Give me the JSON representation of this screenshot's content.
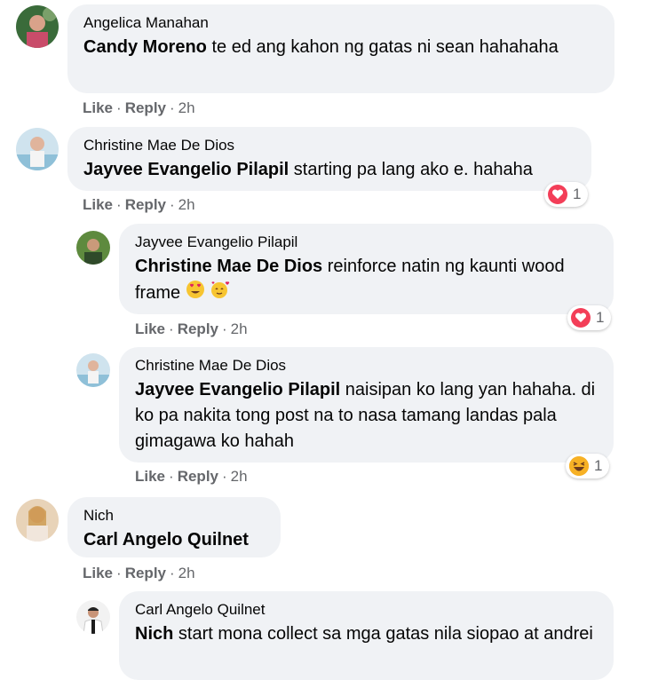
{
  "comments": [
    {
      "author": "Angelica Manahan",
      "mention": "Candy Moreno",
      "text": " te ed ang kahon ng gatas ni sean hahahaha",
      "like": "Like",
      "reply": "Reply",
      "time": "2h"
    },
    {
      "author": "Christine Mae De Dios",
      "mention": "Jayvee Evangelio Pilapil",
      "text": " starting pa lang ako e. hahaha",
      "like": "Like",
      "reply": "Reply",
      "time": "2h",
      "reaction": {
        "icon": "heart-icon",
        "count": "1"
      }
    },
    {
      "author": "Jayvee Evangelio Pilapil",
      "mention": "Christine Mae De Dios",
      "text": " reinforce natin ng kaunti wood frame",
      "like": "Like",
      "reply": "Reply",
      "time": "2h",
      "reaction": {
        "icon": "heart-icon",
        "count": "1"
      }
    },
    {
      "author": "Christine Mae De Dios",
      "mention": "Jayvee Evangelio Pilapil",
      "text": " naisipan ko lang yan hahaha. di ko pa nakita tong post na to nasa tamang landas pala gimagawa ko hahah",
      "like": "Like",
      "reply": "Reply",
      "time": "2h",
      "reaction": {
        "icon": "haha-icon",
        "count": "1"
      }
    },
    {
      "author": "Nich",
      "mention": "Carl Angelo Quilnet",
      "text": "",
      "like": "Like",
      "reply": "Reply",
      "time": "2h"
    },
    {
      "author": "Carl Angelo Quilnet",
      "mention": "Nich",
      "text": " start mona collect sa mga gatas nila siopao at andrei"
    }
  ],
  "separator": "·",
  "colors": {
    "bubble": "#f0f2f5",
    "meta": "#65676b",
    "love": "#f33e58",
    "haha": "#f7b125"
  }
}
